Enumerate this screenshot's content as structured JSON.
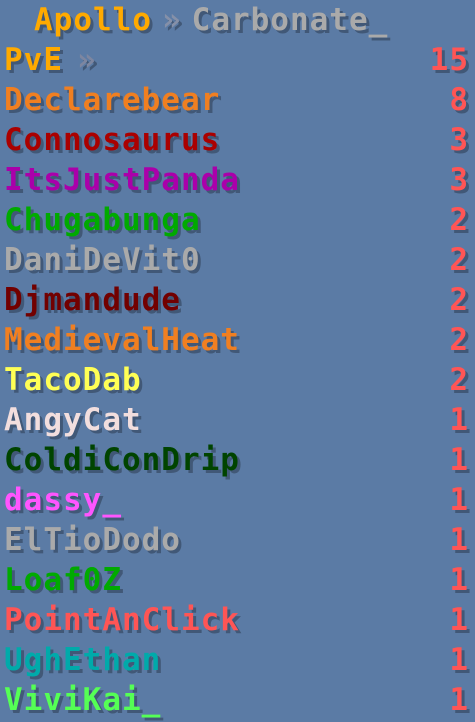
{
  "title": {
    "server": "Apollo",
    "separator": "»",
    "channel": "Carbonate_"
  },
  "mode": {
    "label": "PvE",
    "separator": "»",
    "total": "15"
  },
  "colors": {
    "background": "#5b7ba5",
    "count": "#ff5555"
  },
  "players": [
    {
      "name": "Declarebear",
      "score": "8",
      "color": "#f07f21"
    },
    {
      "name": "Connosaurus",
      "score": "3",
      "color": "#aa0000"
    },
    {
      "name": "ItsJustPanda",
      "score": "3",
      "color": "#aa00aa"
    },
    {
      "name": "Chugabunga",
      "score": "2",
      "color": "#00aa00"
    },
    {
      "name": "DaniDeVit0",
      "score": "2",
      "color": "#aaaaaa"
    },
    {
      "name": "Djmandude",
      "score": "2",
      "color": "#720000"
    },
    {
      "name": "MedievalHeat",
      "score": "2",
      "color": "#f07f21"
    },
    {
      "name": "TacoDab",
      "score": "2",
      "color": "#ffff55"
    },
    {
      "name": "AngyCat",
      "score": "1",
      "color": "#f2dede"
    },
    {
      "name": "ColdiConDrip",
      "score": "1",
      "color": "#004400"
    },
    {
      "name": "dassy_",
      "score": "1",
      "color": "#ff55ff"
    },
    {
      "name": "ElTioDodo",
      "score": "1",
      "color": "#aaaaaa"
    },
    {
      "name": "Loaf0Z",
      "score": "1",
      "color": "#00aa00"
    },
    {
      "name": "PointAnClick",
      "score": "1",
      "color": "#ff5555"
    },
    {
      "name": "UghEthan",
      "score": "1",
      "color": "#00aaaa"
    },
    {
      "name": "ViviKai_",
      "score": "1",
      "color": "#55ff55"
    }
  ]
}
